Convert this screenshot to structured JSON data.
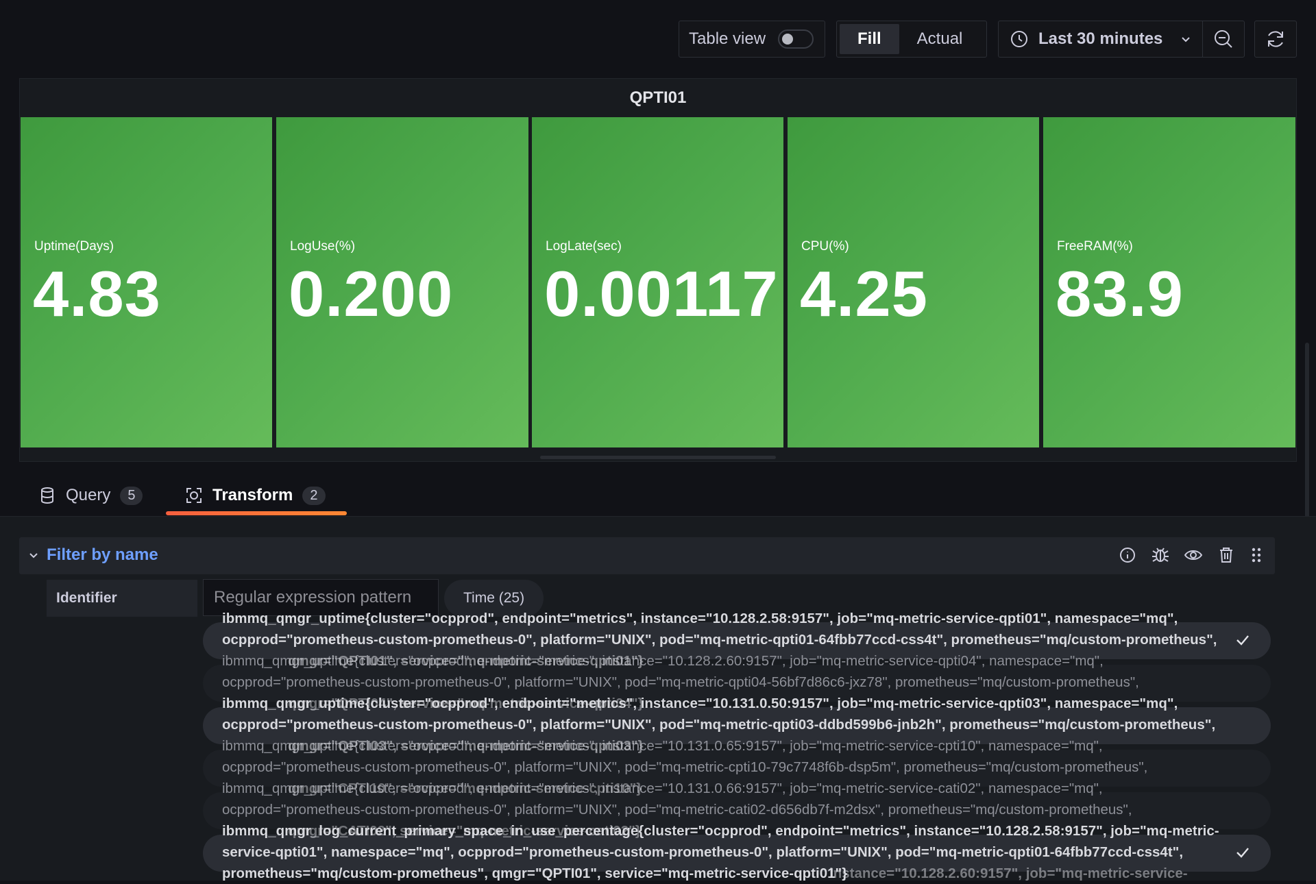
{
  "toolbar": {
    "table_view_label": "Table view",
    "fill_label": "Fill",
    "actual_label": "Actual",
    "time_range_label": "Last 30 minutes"
  },
  "panel": {
    "title": "QPTI01",
    "stats": [
      {
        "label": "Uptime(Days)",
        "value": "4.83"
      },
      {
        "label": "LogUse(%)",
        "value": "0.200"
      },
      {
        "label": "LogLate(sec)",
        "value": "0.00117"
      },
      {
        "label": "CPU(%)",
        "value": "4.25"
      },
      {
        "label": "FreeRAM(%)",
        "value": "83.9"
      }
    ],
    "tile_color": "#4ea94c"
  },
  "tabs": [
    {
      "label": "Query",
      "count": "5"
    },
    {
      "label": "Transform",
      "count": "2"
    }
  ],
  "transform": {
    "title": "Filter by name",
    "identifier_label": "Identifier",
    "regex_placeholder": "Regular expression pattern",
    "time_label": "Time (25)",
    "lines": [
      "ibmmq_qmgr_uptime{cluster=\"ocpprod\", endpoint=\"metrics\", instance=\"10.128.2.58:9157\", job=\"mq-metric-service-qpti01\", namespace=\"mq\",",
      "ocpprod=\"prometheus-custom-prometheus-0\", platform=\"UNIX\", pod=\"mq-metric-qpti01-64fbb77ccd-css4t\", prometheus=\"mq/custom-prometheus\",",
      "ibmmq_qmgr_uptime{cluster=\"ocpprod\", endpoint=\"metrics\", instance=\"10.128.2.60:9157\", job=\"mq-metric-service-qpti04\", namespace=\"mq\",",
      "ocpprod=\"prometheus-custom-prometheus-0\", platform=\"UNIX\", pod=\"mq-metric-qpti04-56bf7d86c6-jxz78\", prometheus=\"mq/custom-prometheus\",",
      "ibmmq_qmgr_uptime{cluster=\"ocpprod\", endpoint=\"metrics\", instance=\"10.131.0.50:9157\", job=\"mq-metric-service-qpti03\", namespace=\"mq\",",
      "ocpprod=\"prometheus-custom-prometheus-0\", platform=\"UNIX\", pod=\"mq-metric-qpti03-ddbd599b6-jnb2h\", prometheus=\"mq/custom-prometheus\",",
      "ibmmq_qmgr_uptime{cluster=\"ocpprod\", endpoint=\"metrics\", instance=\"10.131.0.65:9157\", job=\"mq-metric-service-cpti10\", namespace=\"mq\",",
      "ocpprod=\"prometheus-custom-prometheus-0\", platform=\"UNIX\", pod=\"mq-metric-cpti10-79c7748f6b-dsp5m\", prometheus=\"mq/custom-prometheus\",",
      "ibmmq_qmgr_uptime{cluster=\"ocpprod\", endpoint=\"metrics\", instance=\"10.131.0.66:9157\", job=\"mq-metric-service-cati02\", namespace=\"mq\",",
      "ocpprod=\"prometheus-custom-prometheus-0\", platform=\"UNIX\", pod=\"mq-metric-cati02-d656db7f-m2dsx\", prometheus=\"mq/custom-prometheus\",",
      "ibmmq_qmgr_log_current_primary_space_in_use_percentage{cluster=\"ocpprod\", endpoint=\"metrics\", instance=\"10.128.2.58:9157\", job=\"mq-metric-",
      "service-qpti01\", namespace=\"mq\", ocpprod=\"prometheus-custom-prometheus-0\", platform=\"UNIX\", pod=\"mq-metric-qpti01-64fbb77ccd-css4t\",",
      "prometheus=\"mq/custom-prometheus\", qmgr=\"QPTI01\", service=\"mq-metric-service-qpti01\"}"
    ],
    "overlay_lines": [
      "qmgr=\"QPTI01\", service=\"mq-metric-service-qpti01\"}",
      "qmgr=\"QPTI04\", service=\"mq-metric-service-qpti04\"}",
      "qmgr=\"QPTI03\", service=\"mq-metric-service-qpti03\"}",
      "qmgr=\"CPTI10\", service=\"mq-metric-service-cpti10\"}",
      "qmgr=\"CATI02\", service=\"mq-metric-service-cati02\"}",
      "instance=\"10.128.2.60:9157\", job=\"mq-metric-service-"
    ]
  }
}
